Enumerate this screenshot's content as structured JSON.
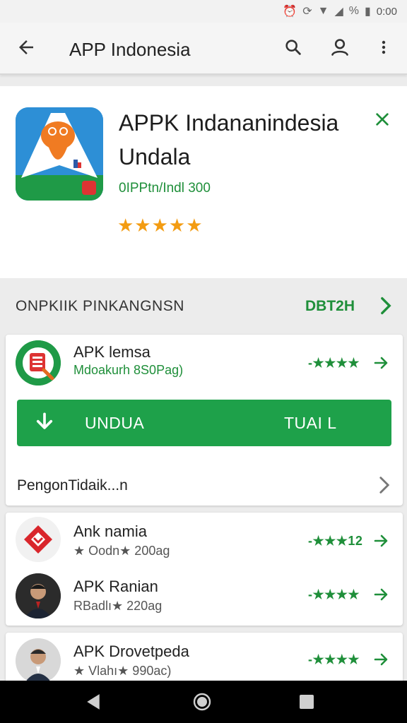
{
  "status": {
    "time": "0:00",
    "battery_icon": "battery-icon",
    "wifi_icon": "wifi-icon"
  },
  "appbar": {
    "title": "APP Indonesia"
  },
  "hero": {
    "app_name": "APPK Indananindesia Undala",
    "meta": "0IPPtn/Indl 300",
    "stars": "★★★★★"
  },
  "section": {
    "title": "ONPKIIK PINKANGNSN",
    "more": "DBT2H"
  },
  "featured": {
    "name": "APK lemsa",
    "sub": "Mdoakurh 8S0Pag)",
    "rating": "-★★★★",
    "install_label": "UNDUA",
    "install_label2": "TUAI L",
    "more_text": "PengonTidaik...n"
  },
  "list": [
    {
      "name": "Ank namia",
      "sub": "★ Oodn★ 200ag",
      "rating": "-★★★12"
    },
    {
      "name": "APK Ranian",
      "sub": "RBadlı★ 220ag",
      "rating": "-★★★★"
    },
    {
      "name": "APK Drovetpeda",
      "sub": "★ Vlahı★ 990ac)",
      "rating": "-★★★★"
    }
  ],
  "colors": {
    "accent": "#1ea14a",
    "star": "#f39c12",
    "navbar": "#000000"
  }
}
